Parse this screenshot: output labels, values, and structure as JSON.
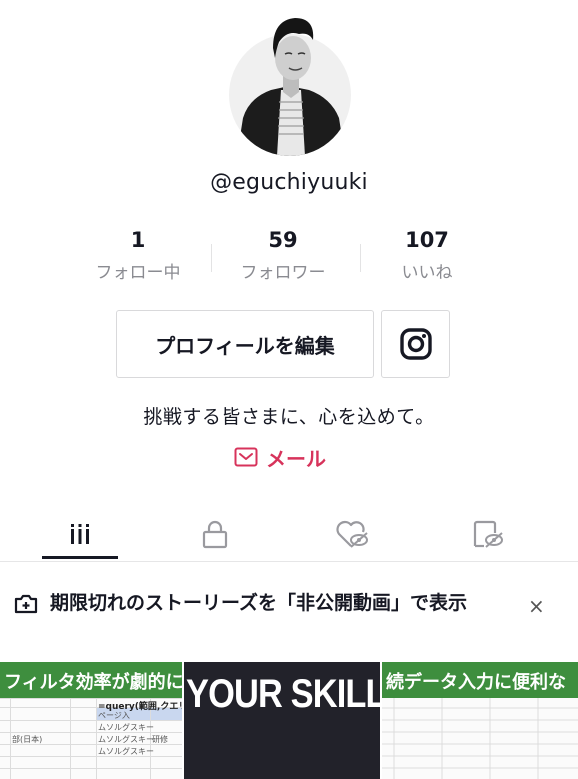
{
  "profile": {
    "username": "@eguchiyuuki",
    "bio": "挑戦する皆さまに、心を込めて。",
    "mail_label": "メール"
  },
  "stats": [
    {
      "value": "1",
      "label": "フォロー中"
    },
    {
      "value": "59",
      "label": "フォロワー"
    },
    {
      "value": "107",
      "label": "いいね"
    }
  ],
  "buttons": {
    "edit_profile": "プロフィールを編集"
  },
  "tabs": [
    {
      "icon": "grid-icon",
      "active": true
    },
    {
      "icon": "lock-icon",
      "active": false
    },
    {
      "icon": "liked-hidden-icon",
      "active": false
    },
    {
      "icon": "favorites-hidden-icon",
      "active": false
    }
  ],
  "banner": {
    "text": "期限切れのストーリーズを「非公開動画」で表示",
    "close": "×"
  },
  "videos": [
    {
      "title": "フィルタ効率が劇的に上がる",
      "sheet_text": "=query(範囲,クエリ,ヘッダー)",
      "cells": [
        "ページ入",
        "ムソルグスキー",
        "ムソルグスキー",
        "ムソルグスキー",
        "研修",
        "部(日本)"
      ]
    },
    {
      "title": "YOUR SKILL U"
    },
    {
      "title": "続データ入力に便利な"
    }
  ],
  "colors": {
    "accent": "#d7335b",
    "text": "#161823",
    "secondary": "#8a8b91",
    "border": "#d9d9db"
  }
}
